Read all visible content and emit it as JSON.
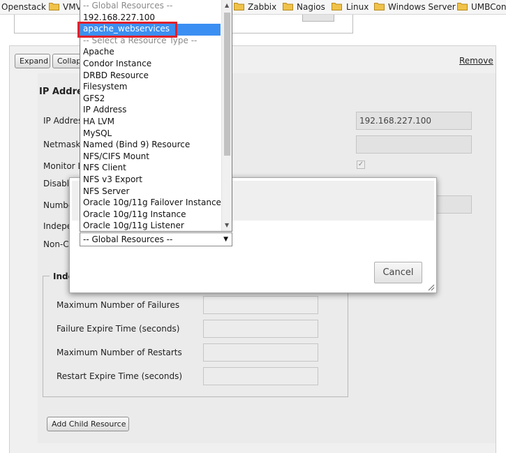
{
  "bookmarks": [
    "Openstack",
    "VMV",
    "Zabbix",
    "Nagios",
    "Linux",
    "Windows Server",
    "UMBConv"
  ],
  "panel": {
    "expand_label": "Expand",
    "collapse_label": "Collap",
    "remove_label": "Remove",
    "section_title": "IP Addre",
    "fields": {
      "ip_label": "IP Addres",
      "netmask_label": "Netmask",
      "monitor_label": "Monitor L",
      "disable_label": "Disable",
      "number_label": "Numbe",
      "indep_label": "Indepe",
      "noncritical_label": "Non-C",
      "ip_value": "192.168.227.100",
      "monitor_checked": "✓"
    },
    "child": {
      "legend": "Inde",
      "max_failures_label": "Maximum Number of Failures",
      "failure_expire_label": "Failure Expire Time (seconds)",
      "max_restarts_label": "Maximum Number of Restarts",
      "restart_expire_label": "Restart Expire Time (seconds)"
    },
    "add_child_label": "Add Child Resource"
  },
  "dialog": {
    "select_value": "-- Global Resources --",
    "cancel_label": "Cancel"
  },
  "dropdown": {
    "options": [
      {
        "label": "-- Global Resources --",
        "group": true
      },
      {
        "label": "192.168.227.100"
      },
      {
        "label": "apache_webservices",
        "selected": true
      },
      {
        "label": "-- Select a Resource Type --",
        "group": true
      },
      {
        "label": "Apache"
      },
      {
        "label": "Condor Instance"
      },
      {
        "label": "DRBD Resource"
      },
      {
        "label": "Filesystem"
      },
      {
        "label": "GFS2"
      },
      {
        "label": "IP Address"
      },
      {
        "label": "HA LVM"
      },
      {
        "label": "MySQL"
      },
      {
        "label": "Named (Bind 9) Resource"
      },
      {
        "label": "NFS/CIFS Mount"
      },
      {
        "label": "NFS Client"
      },
      {
        "label": "NFS v3 Export"
      },
      {
        "label": "NFS Server"
      },
      {
        "label": "Oracle 10g/11g Failover Instance"
      },
      {
        "label": "Oracle 10g/11g Instance"
      },
      {
        "label": "Oracle 10g/11g Listener"
      }
    ]
  },
  "colors": {
    "selection": "#3b8ff2",
    "highlight_box": "#e0202a",
    "folder": "#f0c24a"
  }
}
